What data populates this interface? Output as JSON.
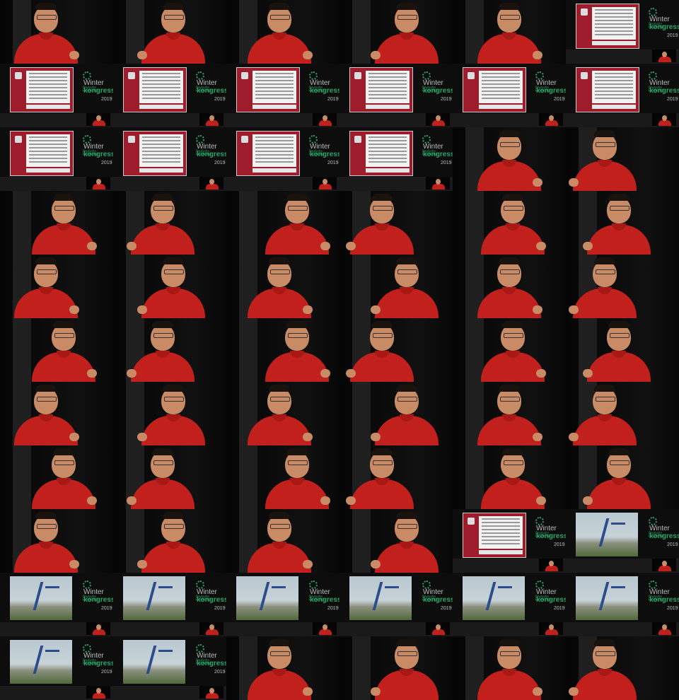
{
  "grid": {
    "columns": 6,
    "rows": 11
  },
  "brand": {
    "org_name": "Deutsche Lungenliga",
    "event_word1": "Winter",
    "event_word2": "kongress",
    "event_year": "2019",
    "colors": {
      "accent_green": "#2aa56a",
      "shirt_red": "#c2201c",
      "ransom_red": "#9e1c2c"
    }
  },
  "frames": [
    "speaker",
    "speaker",
    "speaker",
    "speaker",
    "speaker",
    "slide-ransom",
    "slide-ransom",
    "slide-ransom",
    "slide-ransom",
    "slide-ransom",
    "slide-ransom",
    "slide-ransom",
    "slide-ransom",
    "slide-ransom",
    "slide-ransom",
    "slide-ransom",
    "speaker",
    "speaker",
    "speaker",
    "speaker",
    "speaker",
    "speaker",
    "speaker",
    "speaker",
    "speaker",
    "speaker",
    "speaker",
    "speaker",
    "speaker",
    "speaker",
    "speaker",
    "speaker",
    "speaker",
    "speaker",
    "speaker",
    "speaker",
    "speaker",
    "speaker",
    "speaker",
    "speaker",
    "speaker",
    "speaker",
    "speaker",
    "speaker",
    "speaker",
    "speaker",
    "speaker",
    "speaker",
    "speaker",
    "speaker",
    "speaker",
    "speaker",
    "slide-ransom",
    "slide-port",
    "slide-port",
    "slide-port",
    "slide-port",
    "slide-port",
    "slide-port",
    "slide-port",
    "slide-port",
    "slide-port",
    "speaker",
    "speaker",
    "speaker",
    "speaker"
  ]
}
